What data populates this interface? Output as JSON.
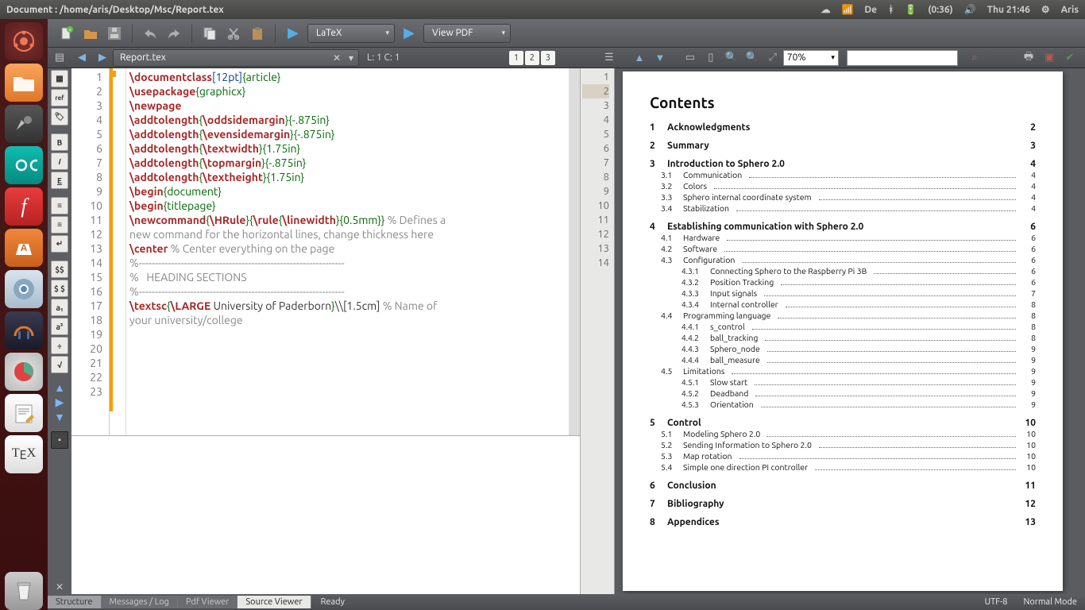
{
  "panel": {
    "title": "Document : /home/aris/Desktop/Msc/Report.tex",
    "lang_ind": "De",
    "battery": "(0:36)",
    "clock": "Thu 21:46",
    "user": "Aris"
  },
  "toolbar": {
    "engine": "LaTeX",
    "view": "View PDF"
  },
  "tabs": {
    "filename": "Report.tex",
    "cursor": "L: 1 C: 1",
    "panel_nums": [
      "1",
      "2",
      "3"
    ],
    "zoom": "70%"
  },
  "gutter_lines": [
    "1",
    "2",
    "3",
    "4",
    "5",
    "6",
    "7",
    "8",
    "9",
    "10",
    "11",
    "12",
    "13",
    "14",
    "15",
    "",
    "16",
    "17",
    "18",
    "19",
    "20",
    "21",
    "22",
    "23"
  ],
  "mini_lines": [
    "1",
    "2",
    "3",
    "4",
    "5",
    "6",
    "7",
    "8",
    "9",
    "10",
    "11",
    "12",
    "13",
    "14"
  ],
  "mini_highlight_index": 1,
  "code_lines": [
    {
      "t": "plain",
      "s": ""
    },
    {
      "t": "tex",
      "parts": [
        [
          "cmd",
          "\\documentclass"
        ],
        [
          "bracket",
          "[12pt]"
        ],
        [
          "brace",
          "{article}"
        ]
      ]
    },
    {
      "t": "tex",
      "parts": [
        [
          "cmd",
          "\\usepackage"
        ],
        [
          "brace",
          "{graphicx}"
        ]
      ]
    },
    {
      "t": "tex",
      "parts": [
        [
          "cmd",
          "\\newpage"
        ]
      ]
    },
    {
      "t": "tex",
      "parts": [
        [
          "cmd",
          "\\addtolength"
        ],
        [
          "brace",
          "{"
        ],
        [
          "cmd",
          "\\oddsidemargin"
        ],
        [
          "brace",
          "}{-.875in}"
        ]
      ]
    },
    {
      "t": "tex",
      "parts": [
        [
          "cmd",
          "\\addtolength"
        ],
        [
          "brace",
          "{"
        ],
        [
          "cmd",
          "\\evensidemargin"
        ],
        [
          "brace",
          "}{-.875in}"
        ]
      ]
    },
    {
      "t": "tex",
      "parts": [
        [
          "cmd",
          "\\addtolength"
        ],
        [
          "brace",
          "{"
        ],
        [
          "cmd",
          "\\textwidth"
        ],
        [
          "brace",
          "}{1.75in}"
        ]
      ]
    },
    {
      "t": "plain",
      "s": ""
    },
    {
      "t": "tex",
      "parts": [
        [
          "cmd",
          "\\addtolength"
        ],
        [
          "brace",
          "{"
        ],
        [
          "cmd",
          "\\topmargin"
        ],
        [
          "brace",
          "}{-.875in}"
        ]
      ]
    },
    {
      "t": "tex",
      "parts": [
        [
          "cmd",
          "\\addtolength"
        ],
        [
          "brace",
          "{"
        ],
        [
          "cmd",
          "\\textheight"
        ],
        [
          "brace",
          "}{1.75in}"
        ]
      ]
    },
    {
      "t": "tex",
      "parts": [
        [
          "cmd",
          "\\begin"
        ],
        [
          "brace",
          "{document}"
        ]
      ]
    },
    {
      "t": "plain",
      "s": ""
    },
    {
      "t": "tex",
      "parts": [
        [
          "cmd",
          "\\begin"
        ],
        [
          "brace",
          "{titlepage}"
        ]
      ]
    },
    {
      "t": "plain",
      "s": ""
    },
    {
      "t": "tex",
      "parts": [
        [
          "cmd",
          "\\newcommand"
        ],
        [
          "brace",
          "{"
        ],
        [
          "cmd",
          "\\HRule"
        ],
        [
          "brace",
          "}{"
        ],
        [
          "cmd",
          "\\rule"
        ],
        [
          "brace",
          "{"
        ],
        [
          "cmd",
          "\\linewidth"
        ],
        [
          "brace",
          "}{0.5mm}} "
        ],
        [
          "comment",
          "% Defines a"
        ]
      ]
    },
    {
      "t": "comment",
      "s": "new command for the horizontal lines, change thickness here"
    },
    {
      "t": "plain",
      "s": ""
    },
    {
      "t": "tex",
      "parts": [
        [
          "cmd",
          "\\center"
        ],
        [
          "plain",
          " "
        ],
        [
          "comment",
          "% Center everything on the page"
        ]
      ]
    },
    {
      "t": "plain",
      "s": ""
    },
    {
      "t": "comment",
      "s": "%----------------------------------------------------------------"
    },
    {
      "t": "comment",
      "s": "%   HEADING SECTIONS"
    },
    {
      "t": "comment",
      "s": "%----------------------------------------------------------------"
    },
    {
      "t": "plain",
      "s": ""
    },
    {
      "t": "tex",
      "parts": [
        [
          "cmd",
          "\\textsc"
        ],
        [
          "brace",
          "{"
        ],
        [
          "cmd",
          "\\LARGE"
        ],
        [
          "plain",
          " University of Paderborn"
        ],
        [
          "brace",
          "}"
        ],
        [
          "plain",
          "\\\\[1.5cm] "
        ],
        [
          "comment",
          "% Name of"
        ]
      ]
    },
    {
      "t": "comment",
      "s": "your university/college"
    }
  ],
  "pdf": {
    "contents_title": "Contents",
    "toc": [
      {
        "lvl": "sec",
        "n": "1",
        "t": "Acknowledgments",
        "p": "2"
      },
      {
        "lvl": "sec",
        "n": "2",
        "t": "Summary",
        "p": "3"
      },
      {
        "lvl": "sec",
        "n": "3",
        "t": "Introduction to Sphero 2.0",
        "p": "4"
      },
      {
        "lvl": "sub",
        "n": "3.1",
        "t": "Communication",
        "p": "4"
      },
      {
        "lvl": "sub",
        "n": "3.2",
        "t": "Colors",
        "p": "4"
      },
      {
        "lvl": "sub",
        "n": "3.3",
        "t": "Sphero internal coordinate system",
        "p": "4"
      },
      {
        "lvl": "sub",
        "n": "3.4",
        "t": "Stabilization",
        "p": "4"
      },
      {
        "lvl": "sec",
        "n": "4",
        "t": "Establishing communication with Sphero 2.0",
        "p": "6"
      },
      {
        "lvl": "sub",
        "n": "4.1",
        "t": "Hardware",
        "p": "6"
      },
      {
        "lvl": "sub",
        "n": "4.2",
        "t": "Software",
        "p": "6"
      },
      {
        "lvl": "sub",
        "n": "4.3",
        "t": "Configuration",
        "p": "6"
      },
      {
        "lvl": "ssub",
        "n": "4.3.1",
        "t": "Connecting Sphero to the Raspberry Pi 3B",
        "p": "6"
      },
      {
        "lvl": "ssub",
        "n": "4.3.2",
        "t": "Position Tracking",
        "p": "6"
      },
      {
        "lvl": "ssub",
        "n": "4.3.3",
        "t": "Input signals",
        "p": "7"
      },
      {
        "lvl": "ssub",
        "n": "4.3.4",
        "t": "Internal controller",
        "p": "8"
      },
      {
        "lvl": "sub",
        "n": "4.4",
        "t": "Programming language",
        "p": "8"
      },
      {
        "lvl": "ssub",
        "n": "4.4.1",
        "t": "s_control",
        "p": "8"
      },
      {
        "lvl": "ssub",
        "n": "4.4.2",
        "t": "ball_tracking",
        "p": "8"
      },
      {
        "lvl": "ssub",
        "n": "4.4.3",
        "t": "Sphero_node",
        "p": "9"
      },
      {
        "lvl": "ssub",
        "n": "4.4.4",
        "t": "ball_measure",
        "p": "9"
      },
      {
        "lvl": "sub",
        "n": "4.5",
        "t": "Limitations",
        "p": "9"
      },
      {
        "lvl": "ssub",
        "n": "4.5.1",
        "t": "Slow start",
        "p": "9"
      },
      {
        "lvl": "ssub",
        "n": "4.5.2",
        "t": "Deadband",
        "p": "9"
      },
      {
        "lvl": "ssub",
        "n": "4.5.3",
        "t": "Orientation",
        "p": "9"
      },
      {
        "lvl": "sec",
        "n": "5",
        "t": "Control",
        "p": "10"
      },
      {
        "lvl": "sub",
        "n": "5.1",
        "t": "Modeling Sphero 2.0",
        "p": "10"
      },
      {
        "lvl": "sub",
        "n": "5.2",
        "t": "Sending Information to Sphero 2.0",
        "p": "10"
      },
      {
        "lvl": "sub",
        "n": "5.3",
        "t": "Map rotation",
        "p": "10"
      },
      {
        "lvl": "sub",
        "n": "5.4",
        "t": "Simple one direction PI controller",
        "p": "10"
      },
      {
        "lvl": "sec",
        "n": "6",
        "t": "Conclusion",
        "p": "11"
      },
      {
        "lvl": "sec",
        "n": "7",
        "t": "Bibliography",
        "p": "12"
      },
      {
        "lvl": "sec",
        "n": "8",
        "t": "Appendices",
        "p": "13"
      }
    ]
  },
  "status": {
    "tabs": [
      "Structure",
      "Messages / Log",
      "Pdf Viewer",
      "Source Viewer"
    ],
    "active_tab_index": 3,
    "message": "Ready",
    "encoding": "UTF-8",
    "mode": "Normal Mode"
  }
}
